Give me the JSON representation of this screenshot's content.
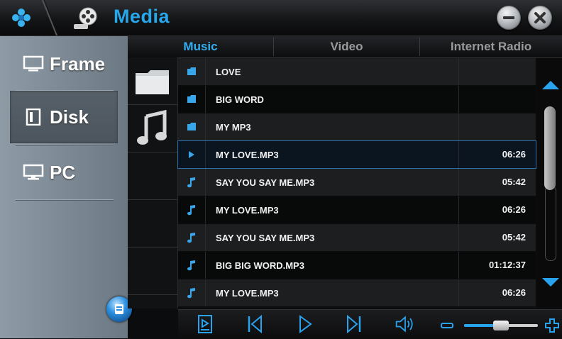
{
  "app": {
    "title": "Media"
  },
  "sidebar": {
    "items": [
      {
        "label": "Frame",
        "icon": "monitor-icon",
        "active": false
      },
      {
        "label": "Disk",
        "icon": "disk-icon",
        "active": true
      },
      {
        "label": "PC",
        "icon": "pc-icon",
        "active": false
      }
    ]
  },
  "tabs": [
    {
      "label": "Music",
      "active": true
    },
    {
      "label": "Video",
      "active": false
    },
    {
      "label": "Internet Radio",
      "active": false
    }
  ],
  "type_column": [
    {
      "icon": "folder-icon"
    },
    {
      "icon": "music-note-icon"
    }
  ],
  "files": [
    {
      "type": "folder",
      "name": "LOVE",
      "time": ""
    },
    {
      "type": "folder",
      "name": "BIG WORD",
      "time": ""
    },
    {
      "type": "folder",
      "name": "MY MP3",
      "time": ""
    },
    {
      "type": "playing",
      "name": "MY LOVE.MP3",
      "time": "06:26"
    },
    {
      "type": "music",
      "name": "SAY YOU SAY ME.MP3",
      "time": "05:42"
    },
    {
      "type": "music",
      "name": "MY LOVE.MP3",
      "time": "06:26"
    },
    {
      "type": "music",
      "name": "SAY YOU SAY ME.MP3",
      "time": "05:42"
    },
    {
      "type": "music",
      "name": "BIG BIG WORD.MP3",
      "time": "01:12:37"
    },
    {
      "type": "music",
      "name": "MY LOVE.MP3",
      "time": "06:26"
    }
  ],
  "selected_index": 3,
  "volume": {
    "level": 0.5
  },
  "colors": {
    "accent": "#27a8ec",
    "title": "#27a8ec",
    "sidebar": "#7d8994"
  }
}
